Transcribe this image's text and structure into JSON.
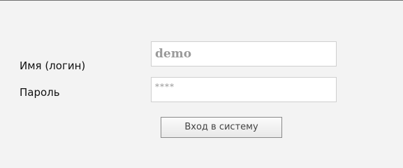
{
  "form": {
    "login_label": "Имя (логин)",
    "login_value": "demo",
    "password_label": "Пароль",
    "password_value": "****",
    "submit_label": "Вход в систему"
  }
}
